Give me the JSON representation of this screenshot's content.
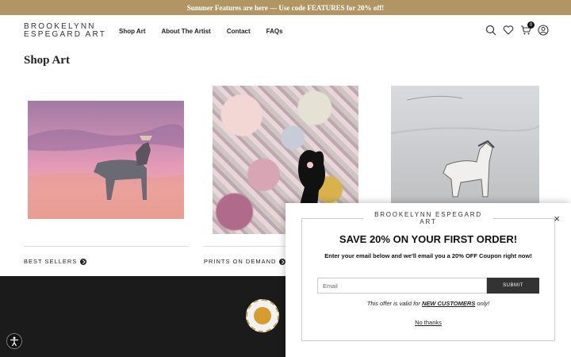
{
  "announcement": "Summer Features are here — Use code FEATURES for 20% off!",
  "brand": {
    "line1": "BROOKELYNN",
    "line2": "ESPEGARD ART"
  },
  "nav": [
    "Shop Art",
    "About The Artist",
    "Contact",
    "FAQs"
  ],
  "header_icons": [
    "search-icon",
    "heart-icon",
    "cart-icon",
    "account-icon"
  ],
  "cart_count": "0",
  "page_title": "Shop Art",
  "categories": [
    {
      "label": "BEST SELLERS"
    },
    {
      "label": "PRINTS ON DEMAND"
    }
  ],
  "popup": {
    "brand_line1": "BROOKELYNN ESPEGARD",
    "brand_line2": "ART",
    "close": "×",
    "headline": "SAVE 20% ON YOUR FIRST ORDER!",
    "subtext": "Enter your email below and we'll email you a 20% OFF Coupon right now!",
    "email_placeholder": "Email",
    "submit_label": "SUBMIT",
    "note_prefix": "This offer is valid for ",
    "note_highlight": "NEW CUSTOMERS",
    "note_suffix": " only!",
    "no_thanks": "No thanks"
  },
  "colors": {
    "announcement_bg": "#b19563",
    "footer_bg": "#1b1b1b",
    "submit_bg": "#333333"
  }
}
